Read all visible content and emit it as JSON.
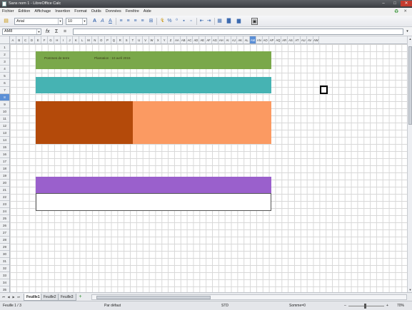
{
  "window": {
    "title": "Sans nom 1 - LibreOffice Calc",
    "controls": {
      "minimize": "–",
      "maximize": "□",
      "close": "✕"
    }
  },
  "menubar": {
    "items": [
      "Fichier",
      "Édition",
      "Affichage",
      "Insertion",
      "Format",
      "Outils",
      "Données",
      "Fenêtre",
      "Aide"
    ],
    "close_doc": "✕"
  },
  "toolbar": {
    "font_name": "Arial",
    "font_size": "10",
    "buttons": [
      "bold-icon",
      "italic-icon",
      "underline-icon",
      "align-left-icon",
      "align-center-icon",
      "align-right-icon",
      "justify-icon",
      "merge-icon",
      "currency-icon",
      "percent-icon",
      "decimal-icon",
      "add-decimal-icon",
      "remove-decimal-icon",
      "indent-icon",
      "outdent-icon",
      "borders-icon",
      "background-color-icon",
      "font-color-icon",
      "sidebar-icon"
    ]
  },
  "formulabar": {
    "cell_ref": "AM8",
    "function_icon": "fx",
    "sum_icon": "Σ",
    "equals_icon": "=",
    "value": ""
  },
  "sheet": {
    "columns": [
      "A",
      "B",
      "C",
      "D",
      "E",
      "F",
      "G",
      "H",
      "I",
      "J",
      "K",
      "L",
      "M",
      "N",
      "O",
      "P",
      "Q",
      "R",
      "S",
      "T",
      "U",
      "V",
      "W",
      "X",
      "Y",
      "Z",
      "AA",
      "AB",
      "AC",
      "AD",
      "AE",
      "AF",
      "AG",
      "AH",
      "AI",
      "AJ",
      "AK",
      "AL",
      "AM",
      "AN",
      "AO",
      "AP",
      "AQ",
      "AR",
      "AS",
      "AT",
      "AU",
      "AV",
      "AW"
    ],
    "selected_column": "AM",
    "rows": [
      "1",
      "2",
      "3",
      "4",
      "5",
      "6",
      "7",
      "8",
      "9",
      "10",
      "11",
      "12",
      "13",
      "14",
      "15",
      "16",
      "17",
      "18",
      "19",
      "20",
      "21",
      "22",
      "23",
      "24",
      "25",
      "26",
      "27",
      "28",
      "29",
      "30",
      "31",
      "32",
      "33",
      "34",
      "35"
    ],
    "selected_row": "8",
    "band1_text_a": "Pommes de terre",
    "band1_text_b": "Plantation : 10 avril 2015",
    "colors": {
      "green": "#7aa84a",
      "teal": "#46b3b3",
      "rust": "#b44a0a",
      "salmon": "#fb9a62",
      "purple": "#9a60cc",
      "white_box_border": "#555555"
    }
  },
  "tabs": {
    "items": [
      "Feuille1",
      "Feuille2",
      "Feuille3"
    ],
    "active": "Feuille1",
    "add": "+"
  },
  "statusbar": {
    "sheet_info": "Feuille 1 / 3",
    "page_style": "Par défaut",
    "language": "STD",
    "sum": "Somme=0",
    "zoom_minus": "–",
    "zoom_plus": "+",
    "zoom": "70%"
  }
}
